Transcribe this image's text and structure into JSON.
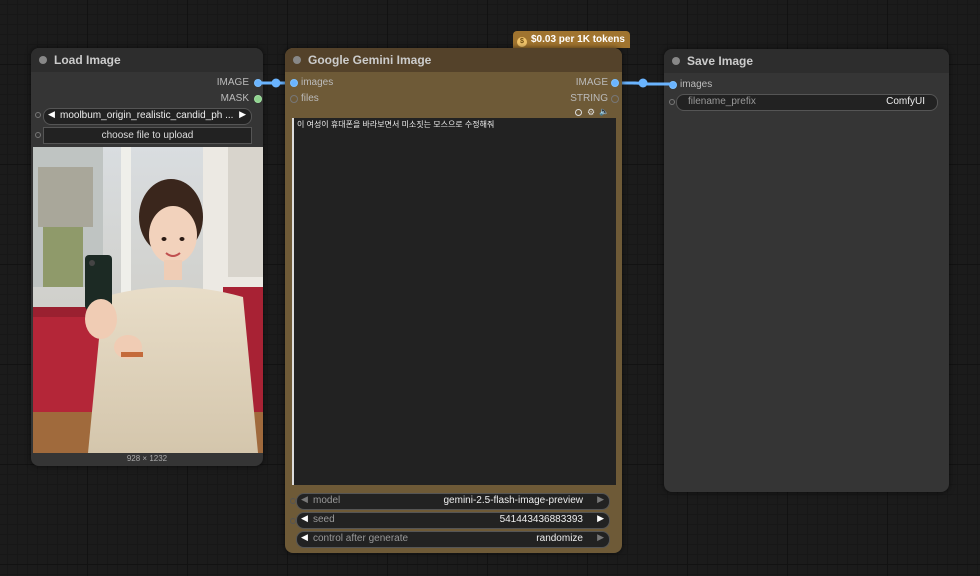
{
  "load_image": {
    "title": "Load Image",
    "outputs": [
      "IMAGE",
      "MASK"
    ],
    "image_select": "moolbum_origin_realistic_candid_ph ...",
    "upload_button": "choose file to upload",
    "dimensions": "928 × 1232"
  },
  "gemini": {
    "title": "Google Gemini Image",
    "badge": "$0.03 per 1K tokens",
    "badge_icon": "$",
    "inputs": [
      "images",
      "files"
    ],
    "outputs": [
      "IMAGE",
      "STRING"
    ],
    "prompt": "이 여성이 휴대폰을 바라보면서 미소짓는 모스으로 수정해줘",
    "widgets": [
      {
        "label": "model",
        "value": "gemini-2.5-flash-image-preview"
      },
      {
        "label": "seed",
        "value": "541443436883393"
      },
      {
        "label": "control after generate",
        "value": "randomize"
      }
    ]
  },
  "save_image": {
    "title": "Save Image",
    "input": "images",
    "filename_label": "filename_prefix",
    "filename_value": "ComfyUI"
  },
  "colors": {
    "canvas": "#1b1b1b",
    "node_body": "#353535",
    "gemini_body": "#6e5a37",
    "gemini_title": "#54422a",
    "link": "#6ab4ff",
    "badge": "#a0742f"
  }
}
